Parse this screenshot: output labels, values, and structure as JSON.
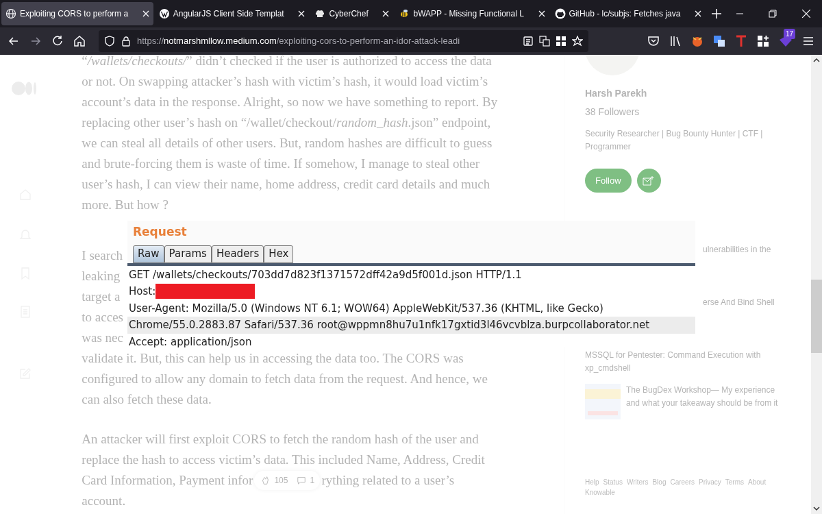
{
  "browser": {
    "tabs": [
      {
        "title": "Exploiting CORS to perform a",
        "selected": true
      },
      {
        "title": "AngularJS Client Side Templat",
        "selected": false
      },
      {
        "title": "CyberChef",
        "selected": false
      },
      {
        "title": "bWAPP - Missing Functional L",
        "selected": false
      },
      {
        "title": "GitHub - lc/subjs: Fetches java",
        "selected": false
      }
    ],
    "url": {
      "scheme": "https://",
      "host": "notmarshmllow.medium.com",
      "path": "/exploiting-cors-to-perform-an-idor-attack-leadi"
    },
    "extension_badge": "17"
  },
  "article": {
    "paragraphs": [
      [
        "“*/wallets/checkouts/*” didn’t checked if the user is authorized to access the data",
        "or not. On swapping attacker’s hash with victim’s hash, it would load victim’s",
        "account’s data in the response. Alright, so now we have something to report. By",
        "replacing other user’s hash on “/wallet/checkout/*random_hash*.json” endpoint,",
        "we can steal all details of other users. But, random hashes are difficult to guess",
        "and brute-forcing them is waste of time. If somehow, I manage to steal other",
        "user’s hash, I can view their name, home address, credit card details and much",
        "more. But how ?"
      ],
      [
        "I search",
        "leaking",
        "target a",
        "to acces",
        "was nec",
        "validate it. But, this can help us in accessing the data too. The CORS was",
        "configured to allow any domain to fetch data from the request. And hence, we",
        "can also fetch these data."
      ],
      [
        "An attacker will first exploit CORS to fetch the random hash of the user and",
        "replace the hash to access victim’s data. This included Name, Address, Credit",
        {
          "before": "Card Information, Payment infor",
          "after": "rything related to a user’s"
        },
        "account."
      ]
    ],
    "claps": "105",
    "responses": "1"
  },
  "author": {
    "name": "Harsh Parekh",
    "followers": "38 Followers",
    "bio": "Security Researcher | Bug Bounty Hunter | CTF | Programmer",
    "follow_button": "Follow"
  },
  "more_from_medium": [
    {
      "title": "ulnerabilities in the",
      "kind": "text"
    },
    {
      "title": "erse And Bind Shell",
      "kind": "text"
    },
    {
      "title": "MSSQL for Pentester: Command Execution with xp_cmdshell",
      "kind": "text"
    },
    {
      "title": "The BugDex Workshop— My experience and what your takeaway should be from it",
      "kind": "thumb"
    }
  ],
  "footer_links": [
    "Help",
    "Status",
    "Writers",
    "Blog",
    "Careers",
    "Privacy",
    "Terms",
    "About",
    "Knowable"
  ],
  "request_screenshot": {
    "title": "Request",
    "tabs": [
      {
        "label": "Raw",
        "selected": true
      },
      {
        "label": "Params",
        "selected": false
      },
      {
        "label": "Headers",
        "selected": false
      },
      {
        "label": "Hex",
        "selected": false
      }
    ],
    "lines": [
      {
        "text": "GET /wallets/checkouts/703dd7d823f1371572dff42a9d5f001d.json HTTP/1.1",
        "highlighted": false,
        "redacted": false
      },
      {
        "text": "Host:",
        "highlighted": false,
        "redacted": true
      },
      {
        "text": "User-Agent: Mozilla/5.0 (Windows NT 6.1; WOW64) AppleWebKit/537.36 (KHTML, like Gecko)",
        "highlighted": false,
        "redacted": false
      },
      {
        "text": "Chrome/55.0.2883.87 Safari/537.36 root@wppmn8hu7u1nfk17gxtid3l46vcvblza.burpcollaborator.net",
        "highlighted": true,
        "redacted": false
      },
      {
        "text": "Accept: application/json",
        "highlighted": false,
        "redacted": false
      }
    ]
  }
}
